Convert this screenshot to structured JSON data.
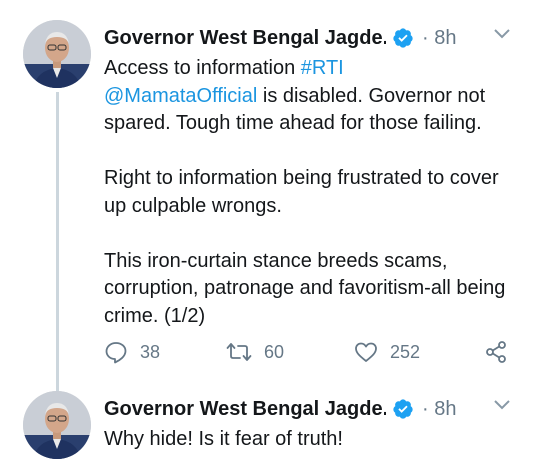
{
  "colors": {
    "link": "#1b95e0",
    "verified": "#1da1f2",
    "secondary_text": "#657786",
    "thread_line": "#ccd6dd"
  },
  "tweets": [
    {
      "author": "Governor West Bengal Jagde...",
      "time_sep": "·",
      "time": "8h",
      "avatar_icon": "portrait-avatar",
      "verified_icon": "verified-badge-icon",
      "menu_icon": "chevron-down-icon",
      "body": {
        "line1_prefix": "Access to information ",
        "hashtag": "#RTI",
        "mention": "@MamataOfficial",
        "line1_suffix": " is disabled. Governor not spared. Tough time ahead for those failing.",
        "paragraph2": "Right to information being frustrated to cover up culpable wrongs.",
        "paragraph3": "This iron-curtain stance breeds scams, corruption, patronage and favoritism-all being crime. (1/2)"
      },
      "actions": {
        "reply_count": "38",
        "retweet_count": "60",
        "like_count": "252"
      }
    },
    {
      "author": "Governor West Bengal Jagde...",
      "time_sep": "·",
      "time": "8h",
      "avatar_icon": "portrait-avatar",
      "verified_icon": "verified-badge-icon",
      "menu_icon": "chevron-down-icon",
      "body": {
        "text": "Why hide! Is it fear of truth!"
      }
    }
  ]
}
